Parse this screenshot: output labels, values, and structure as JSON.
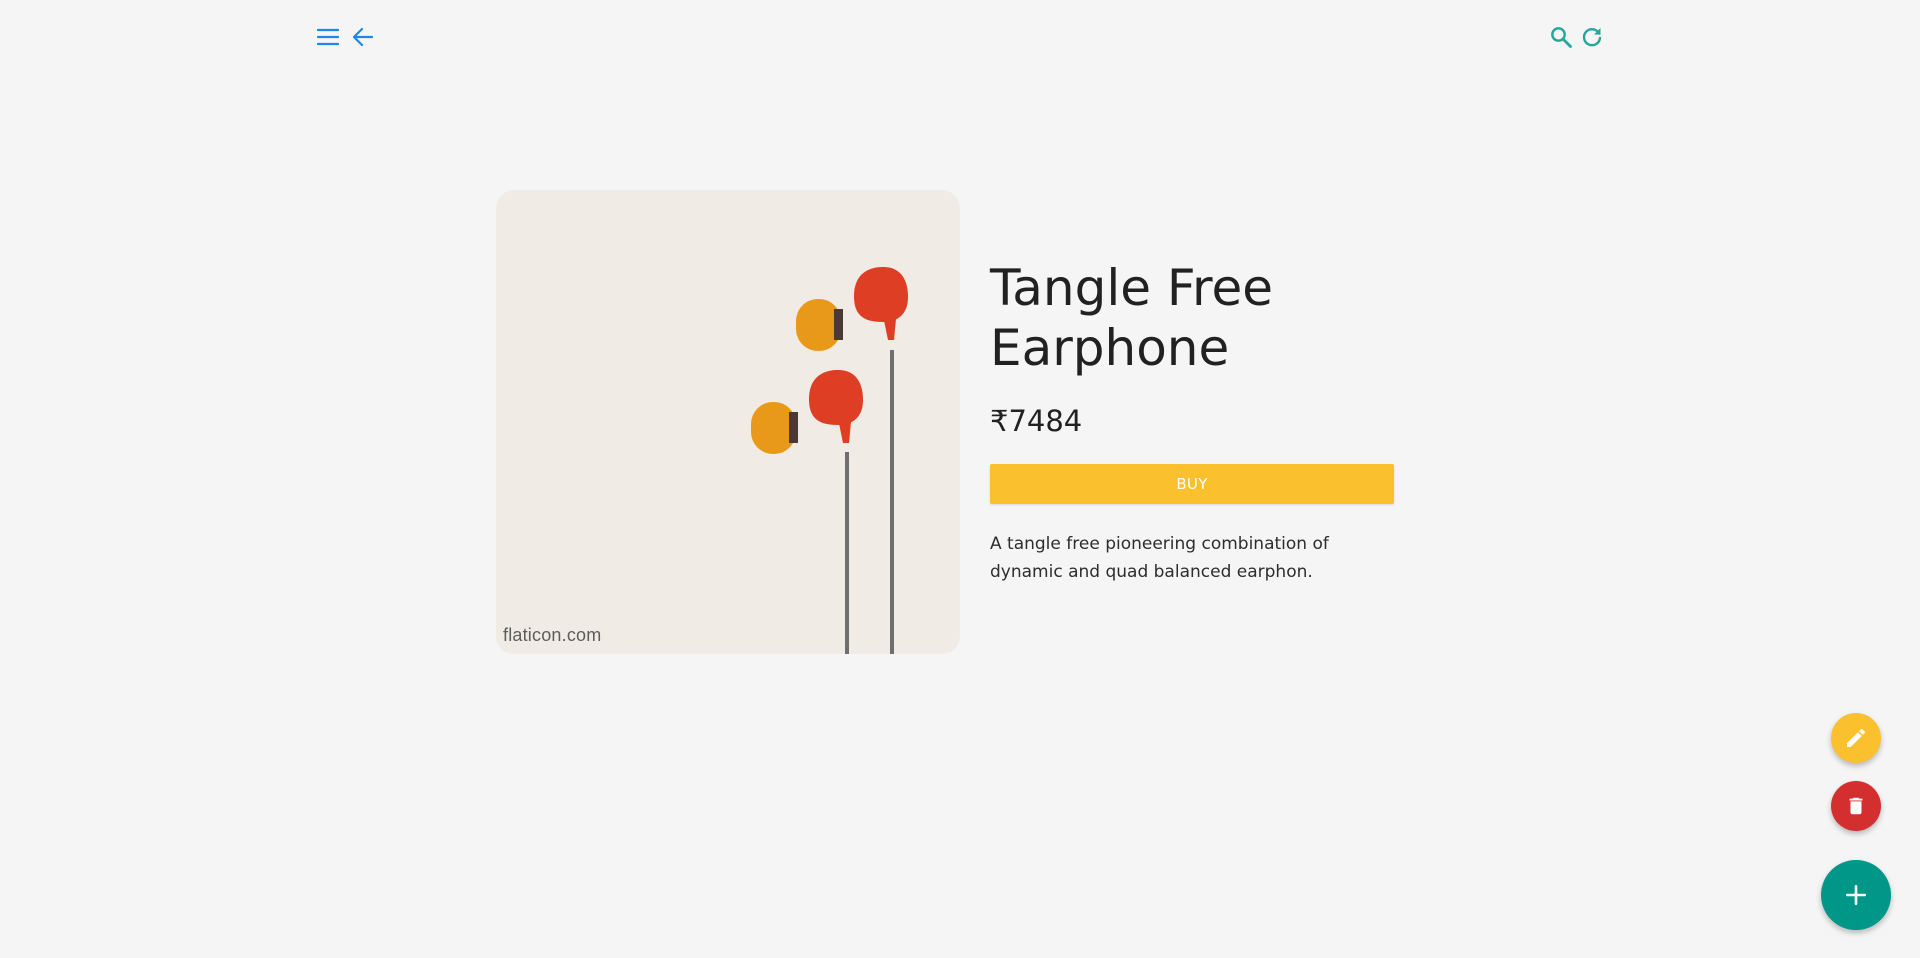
{
  "toolbar": {
    "menu_icon": "menu-icon",
    "back_icon": "arrow-back-icon",
    "search_icon": "search-icon",
    "refresh_icon": "refresh-icon",
    "left_icon_color": "#1e88e5",
    "right_icon_color": "#26a69a"
  },
  "product": {
    "title": "Tangle Free Earphone",
    "price": "₹7484",
    "buy_label": "BUY",
    "description": "A tangle free pioneering combination of dynamic and quad balanced earphon.",
    "image_watermark": "flaticon.com",
    "image_alt": "earphones illustration"
  },
  "fabs": {
    "edit_icon": "pencil-icon",
    "delete_icon": "trash-icon",
    "add_icon": "plus-icon",
    "edit_color": "#fbc02d",
    "delete_color": "#d32f2f",
    "add_color": "#009688"
  },
  "colors": {
    "background": "#f5f5f5",
    "buy_button": "#fbc02d",
    "image_background": "#f0ebe4"
  }
}
